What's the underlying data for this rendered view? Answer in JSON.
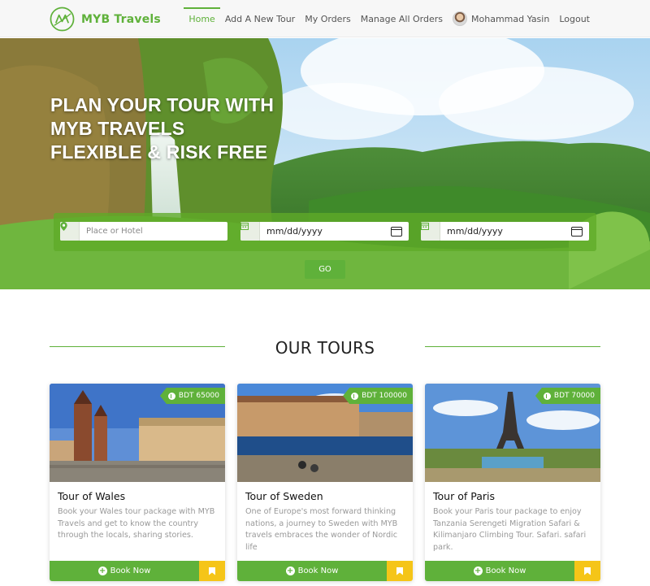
{
  "brand": {
    "name": "MYB Travels"
  },
  "nav": {
    "items": [
      {
        "label": "Home",
        "active": true
      },
      {
        "label": "Add A New Tour",
        "active": false
      },
      {
        "label": "My Orders",
        "active": false
      },
      {
        "label": "Manage All Orders",
        "active": false
      }
    ],
    "user_name": "Mohammad Yasin",
    "logout": "Logout"
  },
  "hero": {
    "title_lines": [
      "PLAN YOUR TOUR WITH",
      "MYB TRAVELS",
      "FLEXIBLE & RISK FREE"
    ],
    "search": {
      "place_placeholder": "Place or Hotel",
      "checkin_value": "mm/dd/yyyy",
      "checkout_value": "mm/dd/yyyy",
      "go_label": "GO"
    }
  },
  "section": {
    "title": "OUR TOURS"
  },
  "tours": [
    {
      "price": "BDT 65000",
      "title": "Tour of Wales",
      "description": "Book your Wales tour package with MYB Travels and get to know the country through the locals, sharing stories.",
      "book_label": "Book Now"
    },
    {
      "price": "BDT 100000",
      "title": "Tour of Sweden",
      "description": "One of Europe's most forward thinking nations, a journey to Sweden with MYB travels embraces the wonder of Nordic life",
      "book_label": "Book Now"
    },
    {
      "price": "BDT 70000",
      "title": "Tour of Paris",
      "description": "Book your Paris tour package to enjoy Tanzania Serengeti Migration Safari & Kilimanjaro Climbing Tour. Safari. safari park.",
      "book_label": "Book Now"
    }
  ],
  "colors": {
    "brand_green": "#5fb13a",
    "bookmark_yellow": "#f5c518"
  }
}
